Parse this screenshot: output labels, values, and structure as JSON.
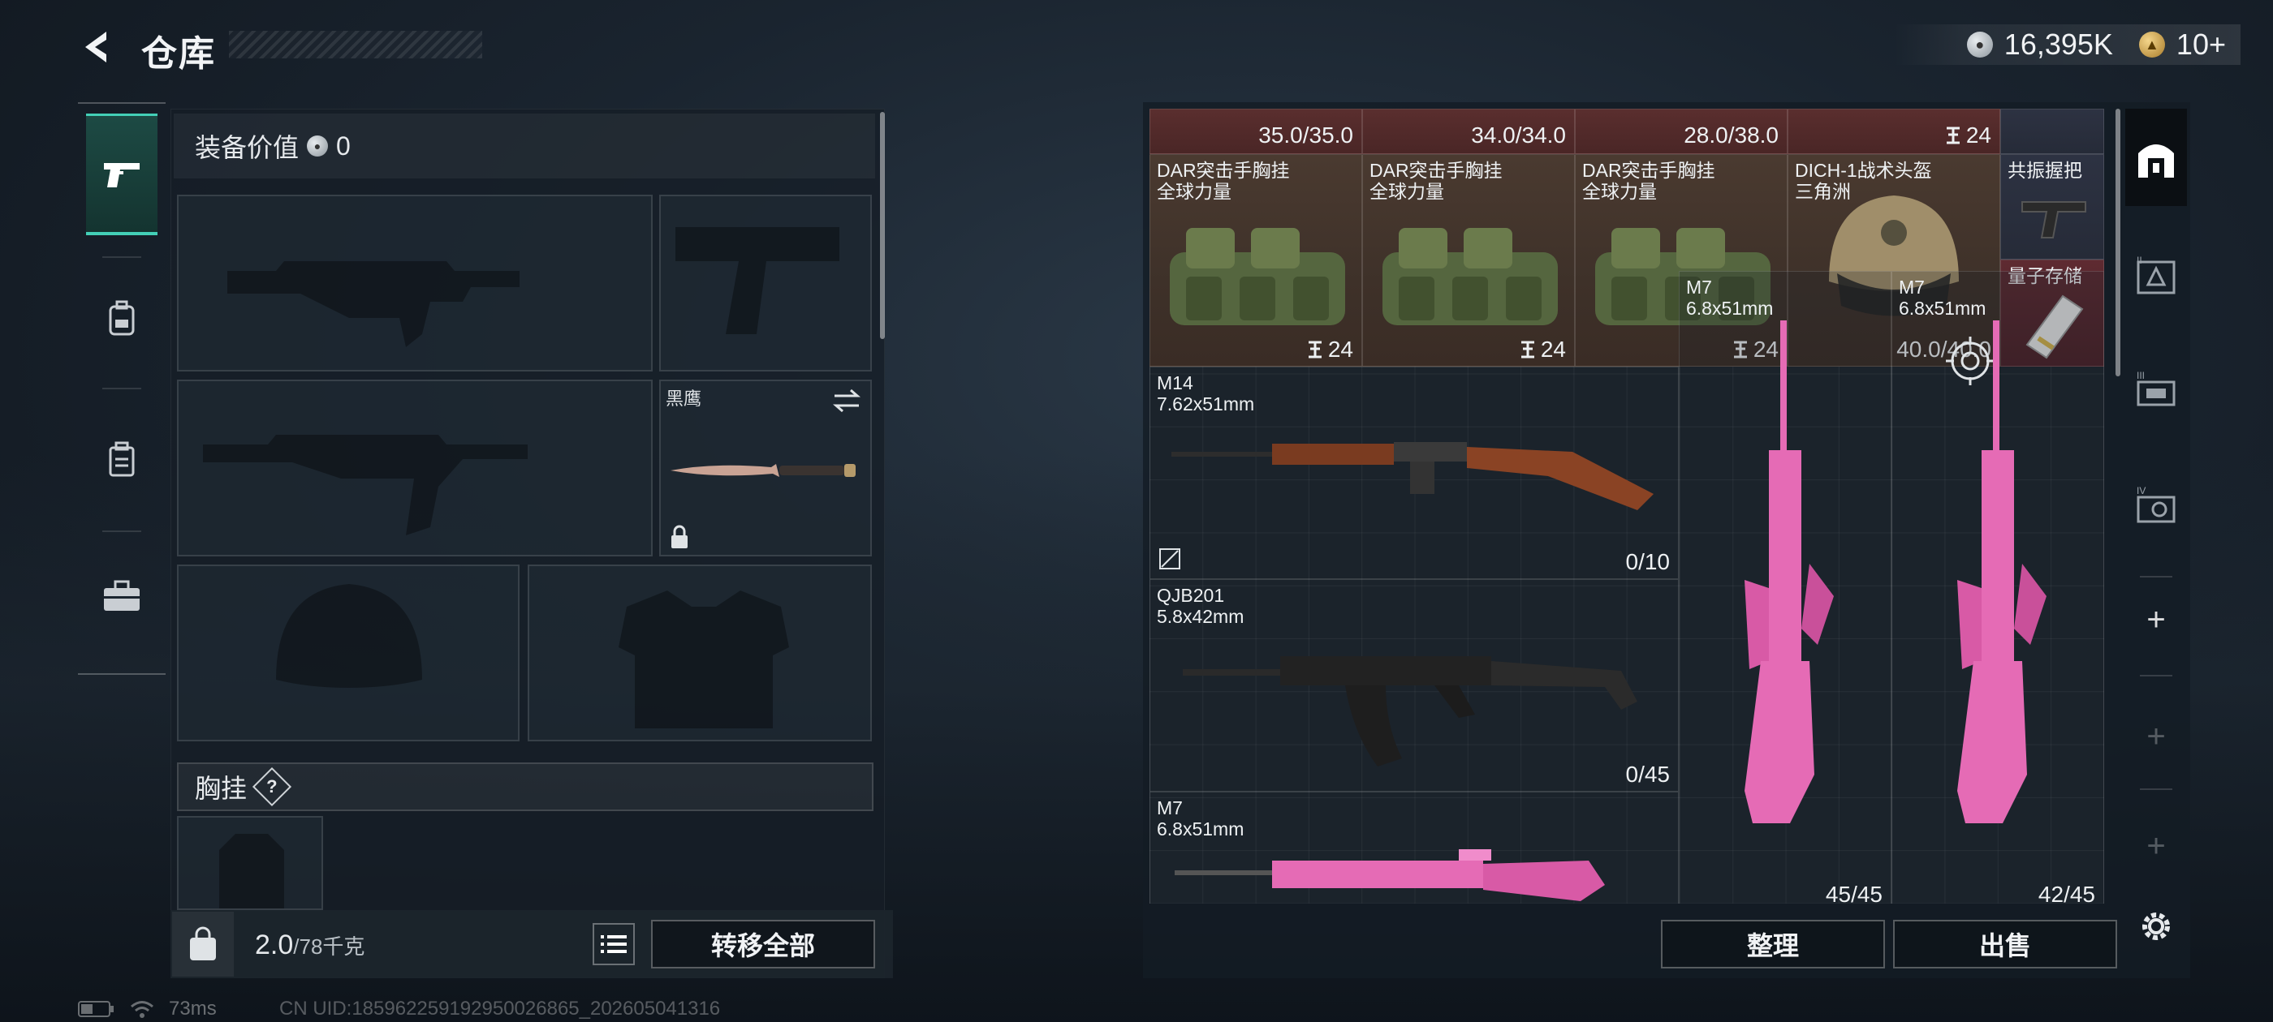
{
  "header": {
    "title": "仓库"
  },
  "currency": [
    {
      "icon": "silver-coin-icon",
      "value": "16,395K"
    },
    {
      "icon": "gold-coin-icon",
      "value": "10+"
    }
  ],
  "left_nav": [
    {
      "name": "weapon-tab",
      "icon": "pistol-icon"
    },
    {
      "name": "backpack-tab",
      "icon": "backpack-icon"
    },
    {
      "name": "locker-tab",
      "icon": "locker-icon"
    },
    {
      "name": "toolkit-tab",
      "icon": "toolbox-icon"
    }
  ],
  "loadout": {
    "value_label": "装备价值",
    "value": "0",
    "melee": {
      "name": "黑鹰"
    },
    "chest_rig_label": "胸挂",
    "chest_rig_help": "?"
  },
  "bottom": {
    "weight_current": "2.0",
    "weight_max": "/78千克",
    "transfer_all": "转移全部",
    "organize": "整理",
    "sell": "出售"
  },
  "status": {
    "ping": "73ms",
    "uid": "CN UID:185962259192950026865_202605041316"
  },
  "inventory": {
    "top_values": [
      "35.0/35.0",
      "34.0/34.0",
      "28.0/38.0",
      "24"
    ],
    "bags": [
      {
        "name": "DAR突击手胸挂",
        "sub": "全球力量",
        "count": "24"
      },
      {
        "name": "DAR突击手胸挂",
        "sub": "全球力量",
        "count": "24"
      },
      {
        "name": "DAR突击手胸挂",
        "sub": "全球力量",
        "count": "24"
      }
    ],
    "helmet": {
      "name": "DICH-1战术头盔",
      "sub": "三角洲",
      "durability": "40.0/40.0"
    },
    "grip": {
      "name": "共振握把"
    },
    "quantum": {
      "name": "量子存储"
    },
    "guns": [
      {
        "name": "M14",
        "caliber": "7.62x51mm",
        "ammo": "0/10"
      },
      {
        "name": "QJB201",
        "caliber": "5.8x42mm",
        "ammo": "0/45"
      },
      {
        "name": "M7",
        "caliber": "6.8x51mm",
        "ammo": ""
      },
      {
        "name": "M7",
        "caliber": "6.8x51mm",
        "ammo": "45/45"
      },
      {
        "name": "M7",
        "caliber": "6.8x51mm",
        "ammo": "42/45"
      }
    ]
  },
  "right_tabs": [
    "inventory-main",
    "tier-2-box",
    "tier-3-box",
    "tier-4-box"
  ],
  "colors": {
    "accent": "#43d0b7",
    "pink_skin": "#e56bb5"
  }
}
